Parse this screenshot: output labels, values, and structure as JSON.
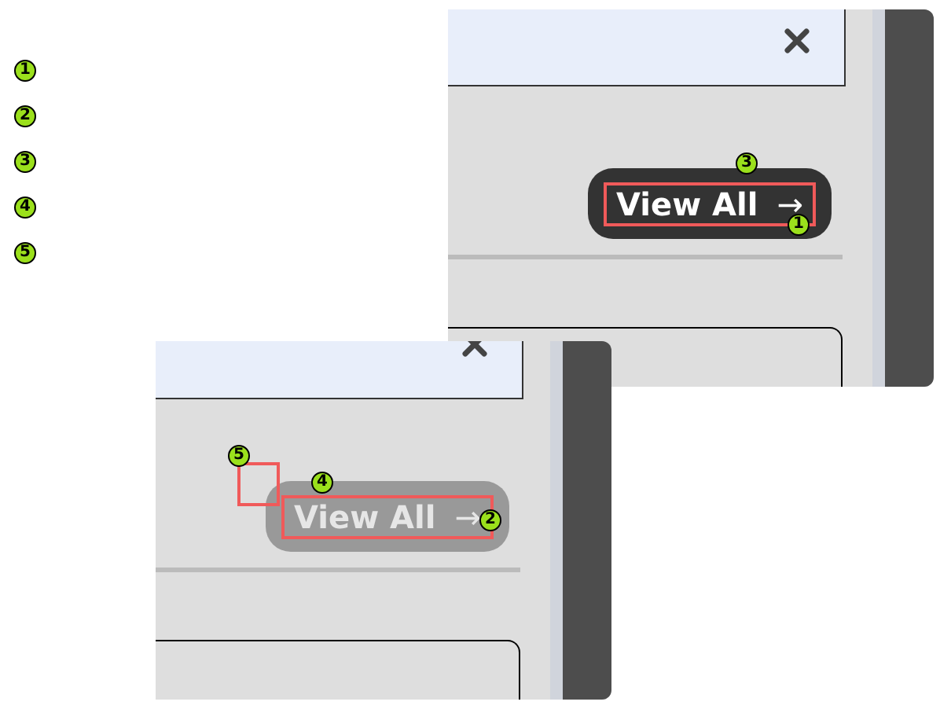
{
  "legend": [
    "1",
    "2",
    "3",
    "4",
    "5"
  ],
  "panels": [
    {
      "button": {
        "label": "View All",
        "arrow": "→",
        "disabled": false
      },
      "badges": [
        "3",
        "1"
      ]
    },
    {
      "button": {
        "label": "View All",
        "arrow": "→",
        "disabled": true
      },
      "badges": [
        "5",
        "4",
        "2"
      ]
    }
  ]
}
